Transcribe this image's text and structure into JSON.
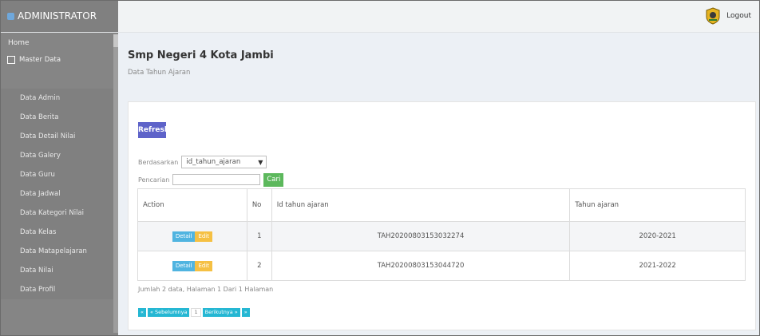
{
  "brand": {
    "title": "ADMINISTRATOR"
  },
  "topbar": {
    "logout": "Logout"
  },
  "sidebar": {
    "home": "Home",
    "master": "Master Data",
    "items": [
      "Data Admin",
      "Data Berita",
      "Data Detail Nilai",
      "Data Galery",
      "Data Guru",
      "Data Jadwal",
      "Data Kategori Nilai",
      "Data Kelas",
      "Data Matapelajaran",
      "Data Nilai",
      "Data Profil"
    ]
  },
  "header": {
    "school": "Smp Negeri 4 Kota Jambi",
    "subtitle": "Data Tahun Ajaran"
  },
  "toolbar": {
    "refresh": "Refresh"
  },
  "filter": {
    "berdasarkan_label": "Berdasarkan",
    "berdasarkan_value": "id_tahun_ajaran",
    "pencarian_label": "Pencarian",
    "pencarian_value": "",
    "cari": "Cari"
  },
  "table": {
    "headers": [
      "Action",
      "No",
      "Id tahun ajaran",
      "Tahun ajaran"
    ],
    "rows": [
      {
        "detail": "Detail",
        "edit": "Edit",
        "no": "1",
        "id": "TAH20200803153032274",
        "tahun": "2020-2021"
      },
      {
        "detail": "Detail",
        "edit": "Edit",
        "no": "2",
        "id": "TAH20200803153044720",
        "tahun": "2021-2022"
      }
    ]
  },
  "summary": "Jumlah 2 data, Halaman 1 Dari 1 Halaman",
  "pager": {
    "first": "«",
    "prev": "« Sebelumnya",
    "current": "1",
    "next": "Berikutnya »",
    "last": "»"
  },
  "colors": {
    "refresh": "#5e63c9",
    "cari": "#5cb85c",
    "detail": "#50b4e0",
    "edit": "#f5c043",
    "pager": "#25b7d3",
    "sidebar": "#858585"
  }
}
